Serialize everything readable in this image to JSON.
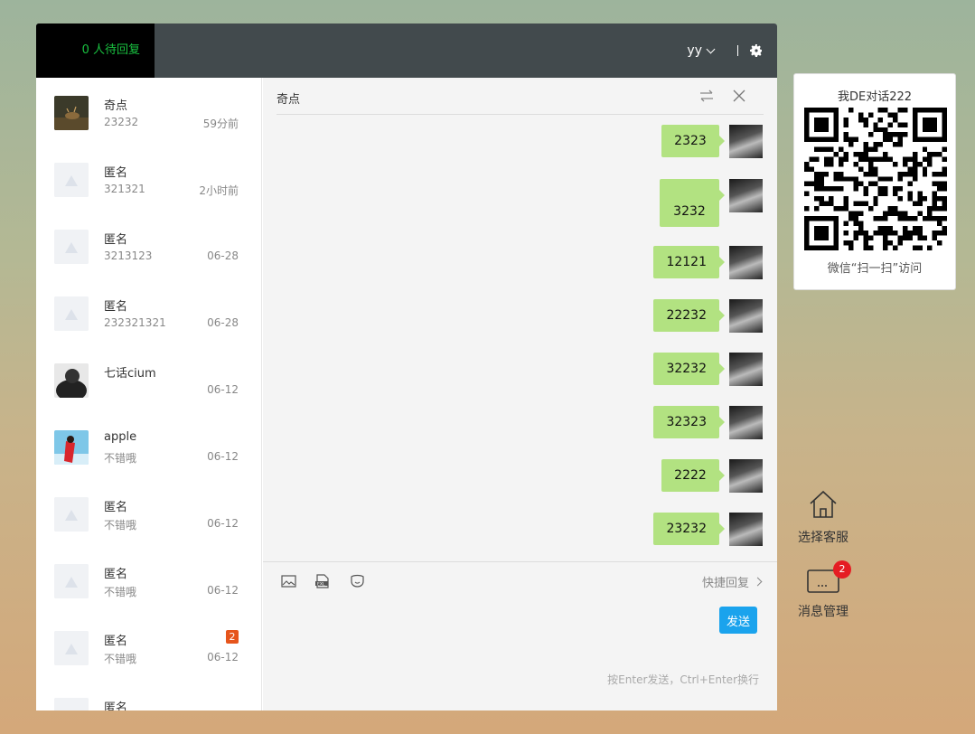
{
  "topbar": {
    "pending_count": "0",
    "pending_label": "人待回复",
    "username": "yy"
  },
  "conversations": [
    {
      "name": "奇点",
      "preview": "23232",
      "time": "59分前",
      "badge": "",
      "avatar": "deer"
    },
    {
      "name": "匿名",
      "preview": "321321",
      "time": "2小时前",
      "badge": "",
      "avatar": "default"
    },
    {
      "name": "匿名",
      "preview": "3213123",
      "time": "06-28",
      "badge": "",
      "avatar": "default"
    },
    {
      "name": "匿名",
      "preview": "232321321",
      "time": "06-28",
      "badge": "",
      "avatar": "default"
    },
    {
      "name": "七话cium",
      "preview": "",
      "time": "06-12",
      "badge": "",
      "avatar": "dark"
    },
    {
      "name": "apple",
      "preview": "不错哦",
      "time": "06-12",
      "badge": "",
      "avatar": "red"
    },
    {
      "name": "匿名",
      "preview": "不错哦",
      "time": "06-12",
      "badge": "",
      "avatar": "default"
    },
    {
      "name": "匿名",
      "preview": "不错哦",
      "time": "06-12",
      "badge": "",
      "avatar": "default"
    },
    {
      "name": "匿名",
      "preview": "不错哦",
      "time": "06-12",
      "badge": "2",
      "avatar": "default"
    },
    {
      "name": "匿名",
      "preview": "",
      "time": "",
      "badge": "",
      "avatar": "default"
    }
  ],
  "chat": {
    "title": "奇点",
    "messages": [
      "2323",
      "3232",
      "12121",
      "22232",
      "32232",
      "32323",
      "2222",
      "23232"
    ],
    "quick_reply": "快捷回复",
    "send_label": "发送",
    "hint": "按Enter发送，Ctrl+Enter换行"
  },
  "qr": {
    "title": "我DE对话222",
    "caption": "微信“扫一扫”访问"
  },
  "side": {
    "select_service": "选择客服",
    "message_mgmt": "消息管理",
    "message_badge": "2"
  },
  "colors": {
    "accent_green": "#19c140",
    "bubble": "#b2e281",
    "send_button": "#1aa3ed",
    "badge_red": "#e51c23",
    "badge_orange": "#e6551c"
  }
}
